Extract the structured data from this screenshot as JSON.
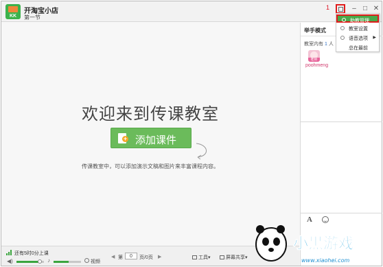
{
  "app": {
    "title": "开淘宝小店",
    "subtitle": "第一节",
    "logo_text": "KK",
    "annotation_number": "1"
  },
  "window_controls": {
    "minimize": "–",
    "maximize": "□",
    "close": "✕"
  },
  "main": {
    "welcome": "欢迎来到传课教室",
    "add_button": "添加课件",
    "hint": "传课教室中，可以添加演示文稿和图片来丰富课程内容。"
  },
  "menu": {
    "items": [
      {
        "label": "助教管理",
        "icon": "user-icon",
        "active": true
      },
      {
        "label": "教室设置",
        "icon": "settings-icon",
        "active": false
      },
      {
        "label": "语音选项",
        "icon": "voice-icon",
        "active": false,
        "has_submenu": true
      },
      {
        "label": "总在最前",
        "icon": "",
        "active": false
      }
    ]
  },
  "right_panel": {
    "mode": "举手模式",
    "count_prefix": "教室内有",
    "count": "1",
    "count_suffix": "人",
    "teacher_tag": "老师",
    "user_name": "poohmeng"
  },
  "bottom": {
    "timer": "还有5时0分上课",
    "volume_level": 0.85,
    "mic_level": 0.55,
    "video_label": "视频",
    "page_prefix": "第",
    "page_value": "0",
    "page_suffix": "页/0页",
    "tools_label": "工具",
    "screen_label": "屏幕共享"
  },
  "watermark": {
    "brand": "小黑游戏",
    "url": "www.xiaohei.com"
  },
  "colors": {
    "accent_green": "#6bbb5b",
    "highlight_red": "#e01a1a",
    "menu_active": "#49a84a"
  }
}
